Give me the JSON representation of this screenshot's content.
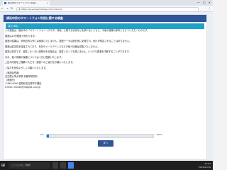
{
  "browser": {
    "tab_title": "横浜市のスマートフォン利用...",
    "tab_close": "×",
    "url": "https://jp.surveymonkey.com/r/xxxxxx",
    "nav_back": "←",
    "nav_forward": "→",
    "nav_reload": "↻",
    "menu": "⋮",
    "minimize": "—",
    "maximize": "□",
    "close": "✕"
  },
  "survey": {
    "header_title": "横浜市民のスマートフォン利用に関する調査",
    "section_title": "はじめに",
    "paragraphs": [
      "この調査は、横浜市の「スマートフォン（スマホ）利用」に関する状況などを調べるとともに、今後の施策の参考とさせていただくものです。",
      "調査は20分程度で終わります。",
      "調査の結果は、学術目的以外には使用いたしません。調査データは統計的に処理され、個人が特定されることはありません。",
      "調査は匿名性を保証されており、氏名やメールアドレスなどの個人情報は収集いたしません。",
      "回答は任意です。回答したくない設問がある場合は、回答しなくても構いません。いつでも調査を中断することができます。",
      "なお、個人情報の保護については十分に配慮いたします。",
      "上記の内容をご理解いただき、調査へのご協力をお願いいたします。",
      "ご協力を何卒よろしくお願いいたします。"
    ],
    "contact_lines": [
      "（実施責任者）",
      "名古屋大学大学院 情報学研究科",
      "（連絡先）",
      "〒464-0000 愛知県名古屋市千種区",
      "E-mail: xxxxxx@nagoya-u.ac.jp"
    ],
    "progress_start": "0%",
    "progress_end": "100%",
    "progress": 0.02,
    "next_button": "次へ"
  },
  "taskbar": {
    "start_icon": "⊞",
    "search_placeholder": "ここに入力して検索",
    "time": "10:57",
    "date": "2019/01/16"
  },
  "colors": {
    "header": "#2f5597",
    "section": "#1fa2c7",
    "progress": "#0d6efd"
  }
}
